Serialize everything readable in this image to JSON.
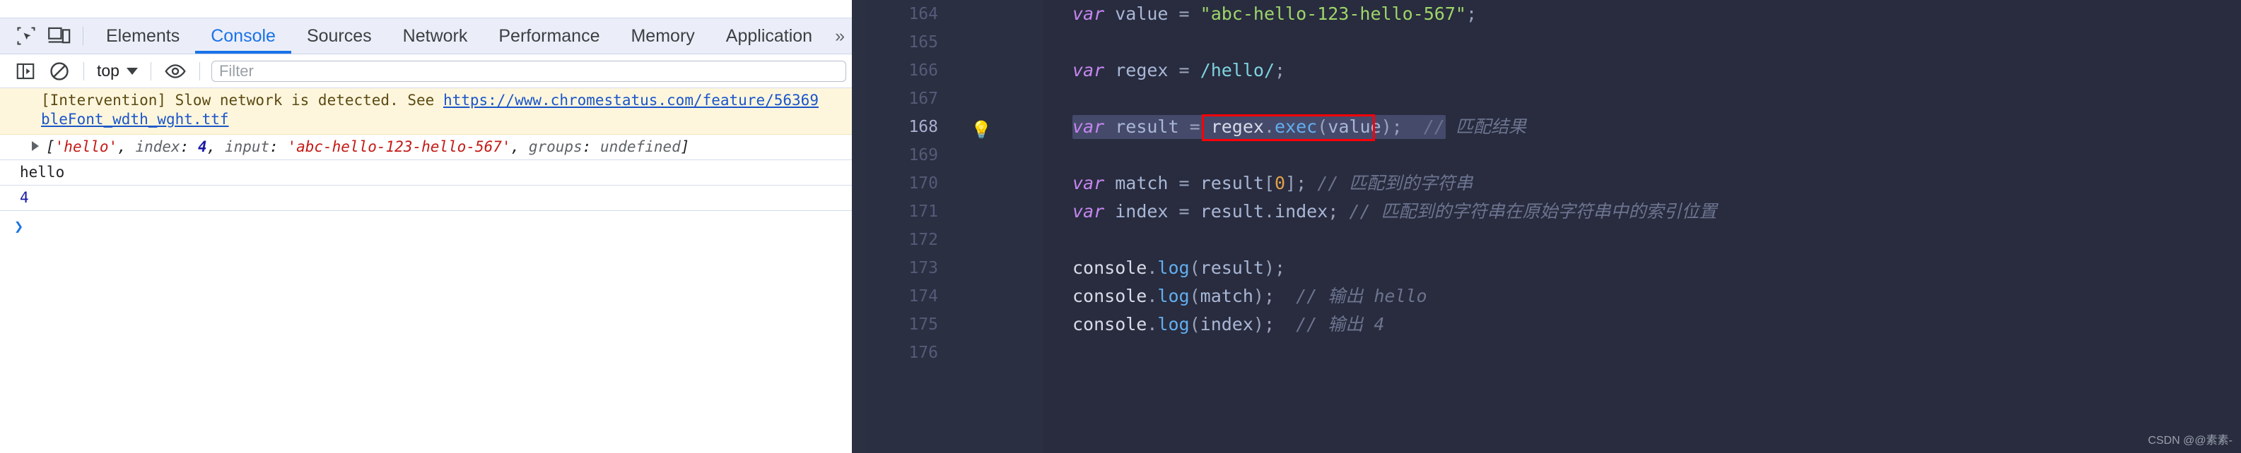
{
  "devtools": {
    "toolbar_icons": [
      {
        "name": "inspect-element-icon",
        "label": "Inspect element"
      },
      {
        "name": "device-toolbar-icon",
        "label": "Toggle device toolbar"
      }
    ],
    "tabs": [
      {
        "label": "Elements",
        "active": false
      },
      {
        "label": "Console",
        "active": true
      },
      {
        "label": "Sources",
        "active": false
      },
      {
        "label": "Network",
        "active": false
      },
      {
        "label": "Performance",
        "active": false
      },
      {
        "label": "Memory",
        "active": false
      },
      {
        "label": "Application",
        "active": false
      }
    ],
    "tab_overflow": "»",
    "console_toolbar": {
      "sidebar_icon": "show-console-sidebar-icon",
      "clear_icon": "clear-console-icon",
      "context_value": "top",
      "eye_icon": "live-expression-icon",
      "filter_placeholder": "Filter"
    },
    "messages": {
      "intervention": {
        "line1_prefix": "[Intervention] Slow network is detected. See ",
        "line1_link": "https://www.chromestatus.com/feature/56369",
        "line2_link": "bleFont_wdth_wght.ttf"
      },
      "rows": [
        {
          "type": "object",
          "expandable": true,
          "parts": [
            {
              "t": "brk",
              "v": "["
            },
            {
              "t": "str",
              "v": "'hello'"
            },
            {
              "t": "brk",
              "v": ", "
            },
            {
              "t": "key",
              "v": "index"
            },
            {
              "t": "brk",
              "v": ": "
            },
            {
              "t": "num",
              "v": "4"
            },
            {
              "t": "brk",
              "v": ", "
            },
            {
              "t": "key",
              "v": "input"
            },
            {
              "t": "brk",
              "v": ": "
            },
            {
              "t": "str",
              "v": "'abc-hello-123-hello-567'"
            },
            {
              "t": "brk",
              "v": ", "
            },
            {
              "t": "key",
              "v": "groups"
            },
            {
              "t": "brk",
              "v": ": "
            },
            {
              "t": "undef",
              "v": "undefined"
            },
            {
              "t": "brk",
              "v": "]"
            }
          ]
        },
        {
          "type": "string",
          "value": "hello"
        },
        {
          "type": "number",
          "value": "4"
        }
      ],
      "prompt": "❯"
    }
  },
  "editor": {
    "theme_bg": "#282c3e",
    "gutter_bg": "#2b2f42",
    "highlight_color": "#fb0007",
    "selection_color": "#454a6b",
    "bulb_icon": "lightbulb-icon",
    "bulb_line": 168,
    "lines": [
      {
        "num": "164",
        "tokens": [
          {
            "t": "kw",
            "v": "var "
          },
          {
            "t": "var",
            "v": "value"
          },
          {
            "t": "op",
            "v": " = "
          },
          {
            "t": "str",
            "v": "\"abc-hello-123-hello-567\""
          },
          {
            "t": "punc",
            "v": ";"
          }
        ]
      },
      {
        "num": "165",
        "tokens": []
      },
      {
        "num": "166",
        "tokens": [
          {
            "t": "kw",
            "v": "var "
          },
          {
            "t": "var",
            "v": "regex"
          },
          {
            "t": "op",
            "v": " = "
          },
          {
            "t": "regex",
            "v": "/hello/"
          },
          {
            "t": "punc",
            "v": ";"
          }
        ]
      },
      {
        "num": "167",
        "tokens": []
      },
      {
        "num": "168",
        "selected": true,
        "boxed": true,
        "tokens": [
          {
            "t": "kw",
            "v": "var "
          },
          {
            "t": "var",
            "v": "result"
          },
          {
            "t": "op",
            "v": " = "
          },
          {
            "t": "obj",
            "v": "regex"
          },
          {
            "t": "punc",
            "v": "."
          },
          {
            "t": "fn",
            "v": "exec"
          },
          {
            "t": "punc",
            "v": "("
          },
          {
            "t": "var",
            "v": "value"
          },
          {
            "t": "punc",
            "v": ")"
          },
          {
            "t": "punc",
            "v": ";"
          },
          {
            "t": "cmt",
            "v": "  // 匹配结果"
          }
        ]
      },
      {
        "num": "169",
        "tokens": []
      },
      {
        "num": "170",
        "tokens": [
          {
            "t": "kw",
            "v": "var "
          },
          {
            "t": "var",
            "v": "match"
          },
          {
            "t": "op",
            "v": " = "
          },
          {
            "t": "var",
            "v": "result"
          },
          {
            "t": "punc",
            "v": "["
          },
          {
            "t": "num",
            "v": "0"
          },
          {
            "t": "punc",
            "v": "]"
          },
          {
            "t": "punc",
            "v": ";"
          },
          {
            "t": "cmt",
            "v": " // 匹配到的字符串"
          }
        ]
      },
      {
        "num": "171",
        "tokens": [
          {
            "t": "kw",
            "v": "var "
          },
          {
            "t": "var",
            "v": "index"
          },
          {
            "t": "op",
            "v": " = "
          },
          {
            "t": "var",
            "v": "result"
          },
          {
            "t": "punc",
            "v": "."
          },
          {
            "t": "prop",
            "v": "index"
          },
          {
            "t": "punc",
            "v": ";"
          },
          {
            "t": "cmt",
            "v": " // 匹配到的字符串在原始字符串中的索引位置"
          }
        ]
      },
      {
        "num": "172",
        "tokens": []
      },
      {
        "num": "173",
        "tokens": [
          {
            "t": "obj",
            "v": "console"
          },
          {
            "t": "punc",
            "v": "."
          },
          {
            "t": "fn",
            "v": "log"
          },
          {
            "t": "punc",
            "v": "("
          },
          {
            "t": "var",
            "v": "result"
          },
          {
            "t": "punc",
            "v": ")"
          },
          {
            "t": "punc",
            "v": ";"
          }
        ]
      },
      {
        "num": "174",
        "tokens": [
          {
            "t": "obj",
            "v": "console"
          },
          {
            "t": "punc",
            "v": "."
          },
          {
            "t": "fn",
            "v": "log"
          },
          {
            "t": "punc",
            "v": "("
          },
          {
            "t": "var",
            "v": "match"
          },
          {
            "t": "punc",
            "v": ")"
          },
          {
            "t": "punc",
            "v": ";"
          },
          {
            "t": "cmt",
            "v": "  // 输出 hello"
          }
        ]
      },
      {
        "num": "175",
        "tokens": [
          {
            "t": "obj",
            "v": "console"
          },
          {
            "t": "punc",
            "v": "."
          },
          {
            "t": "fn",
            "v": "log"
          },
          {
            "t": "punc",
            "v": "("
          },
          {
            "t": "var",
            "v": "index"
          },
          {
            "t": "punc",
            "v": ")"
          },
          {
            "t": "punc",
            "v": ";"
          },
          {
            "t": "cmt",
            "v": "  // 输出 4"
          }
        ]
      },
      {
        "num": "176",
        "tokens": []
      }
    ]
  },
  "watermark": "CSDN @@素素-"
}
